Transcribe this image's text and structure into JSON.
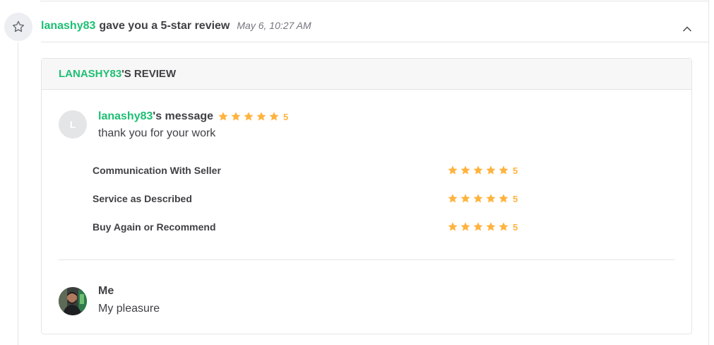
{
  "event": {
    "username": "lanashy83",
    "action_text": "gave you a 5-star review",
    "timestamp": "May 6, 10:27 AM"
  },
  "review": {
    "header_user": "LANASHY83",
    "header_suffix": "'S REVIEW",
    "message_user": "lanashy83",
    "message_suffix": "'s message",
    "avatar_initial": "L",
    "overall_rating": "5",
    "message_text": "thank you for your work",
    "criteria": [
      {
        "label": "Communication With Seller",
        "rating": "5"
      },
      {
        "label": "Service as Described",
        "rating": "5"
      },
      {
        "label": "Buy Again or Recommend",
        "rating": "5"
      }
    ]
  },
  "reply": {
    "author": "Me",
    "text": "My pleasure"
  },
  "colors": {
    "accent_green": "#1dbf73",
    "star_gold": "#ffb33e",
    "text_dark": "#404145",
    "text_muted": "#74767e"
  },
  "icons": {
    "event": "star-outline-icon",
    "collapse": "chevron-up-icon",
    "rating": "star-icon"
  }
}
